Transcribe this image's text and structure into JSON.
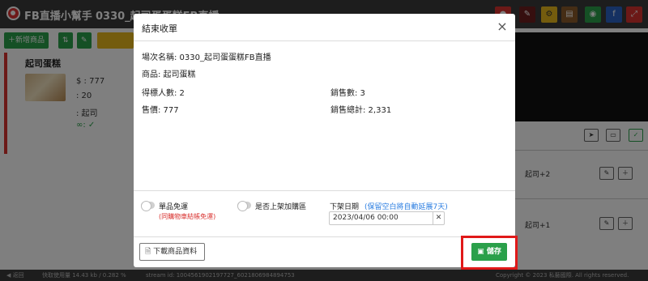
{
  "app": {
    "title": "FB直播小幫手",
    "live_title": "0330_起司蛋蛋糕FB直播",
    "colors": {
      "brand": "#d9322f",
      "topbar": "#3a3a3a",
      "save_green": "#2aa04a",
      "highlight_red": "#e01919"
    }
  },
  "toolbar": {
    "add_product_label": "＋新增商品",
    "icons": [
      "record-icon",
      "wrench-icon",
      "gear-icon",
      "book-icon",
      "line-icon",
      "facebook-icon",
      "expand-icon"
    ]
  },
  "product_card": {
    "name": "起司蛋糕",
    "price": "$ : 777",
    "sold": ": 20",
    "keyword": ": 起司",
    "limit": "∞: ✓"
  },
  "right_panel": {
    "comments": [
      {
        "text": "起司+2"
      },
      {
        "text": "起司+1"
      }
    ]
  },
  "footer": {
    "back_label": "◀ 返回",
    "traffic": "快取使用量 14.43 kb / 0.282 %",
    "stream_id": "stream id: 1004561902197727_6021806984894753",
    "copyright": "Copyright © 2023 私藝國際. All rights reserved."
  },
  "modal": {
    "title": "結束收單",
    "session_label": "場次名稱: 0330_起司蛋蛋糕FB直播",
    "product_label": "商品: 起司蛋糕",
    "winners_label": "得標人數: 2",
    "sales_count_label": "銷售數: 3",
    "price_label": "售價: 777",
    "sales_total_label": "銷售總計: 2,331",
    "free_shipping_label": "單品免運",
    "free_shipping_note": "(同購物車結帳免運)",
    "add_to_cart_label": "是否上架加購區",
    "takedown_label": "下架日期",
    "takedown_note": "(保留空白將自動延展7天)",
    "takedown_value": "2023/04/06 00:00",
    "clear_label": "✕",
    "download_label": "下載商品資料",
    "save_label": "儲存"
  }
}
